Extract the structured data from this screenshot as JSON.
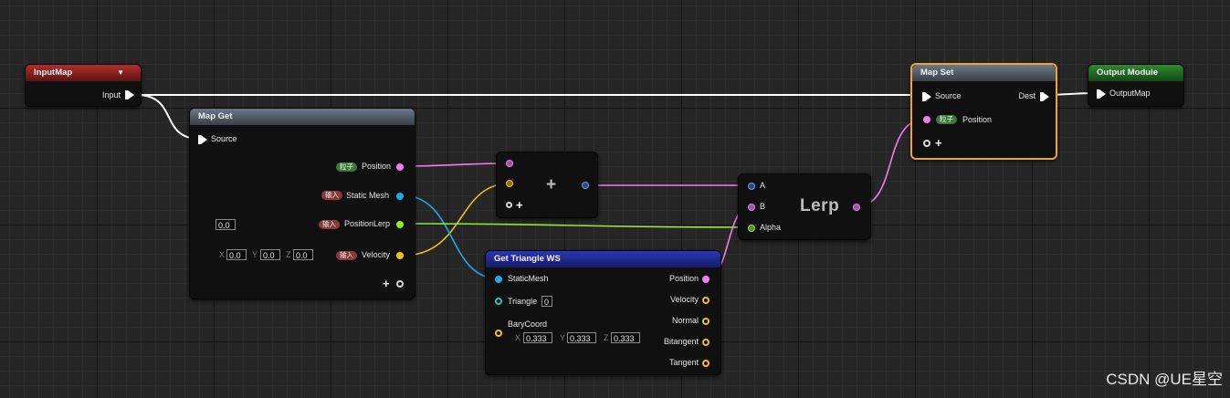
{
  "colors": {
    "position_pin": "#f07cf0",
    "vector_pin": "#f0c020",
    "mesh_pin": "#1fa8ef",
    "float_pin": "#90e836",
    "int_pin": "#27c4b2",
    "exec_wire": "#ffffff",
    "selection_outline": "#f2a431"
  },
  "input_map": {
    "title": "InputMap",
    "dropdown_icon": "caret-down-icon",
    "input_label": "Input"
  },
  "map_get": {
    "title": "Map Get",
    "source_label": "Source",
    "outputs": [
      {
        "badge": "粒子",
        "label": "Position"
      },
      {
        "badge": "输入",
        "label": "Static Mesh"
      },
      {
        "badge": "输入",
        "label": "PositionLerp"
      },
      {
        "badge": "输入",
        "label": "Velocity"
      }
    ],
    "positionlerp_default": "0.0",
    "velocity_default": {
      "x_label": "X",
      "x": "0.0",
      "y_label": "Y",
      "y": "0.0",
      "z_label": "Z",
      "z": "0.0"
    },
    "add_icon": "plus-icon"
  },
  "add_node": {
    "op_symbol": "+",
    "add_icon": "plus-icon"
  },
  "get_triangle": {
    "title": "Get Triangle WS",
    "inputs": {
      "static_mesh": "StaticMesh",
      "triangle": "Triangle",
      "triangle_value": "0",
      "barycoord": "BaryCoord",
      "bary": {
        "x_label": "X",
        "x": "0.333",
        "y_label": "Y",
        "y": "0.333",
        "z_label": "Z",
        "z": "0.333"
      }
    },
    "outputs": [
      "Position",
      "Velocity",
      "Normal",
      "Bitangent",
      "Tangent"
    ]
  },
  "lerp": {
    "title": "Lerp",
    "a": "A",
    "b": "B",
    "alpha": "Alpha"
  },
  "map_set": {
    "title": "Map Set",
    "source_label": "Source",
    "dest_label": "Dest",
    "position_badge": "粒子",
    "position_label": "Position",
    "add_icon": "plus-icon"
  },
  "output_module": {
    "title": "Output Module",
    "output_map_label": "OutputMap"
  },
  "watermark": "CSDN @UE星空"
}
